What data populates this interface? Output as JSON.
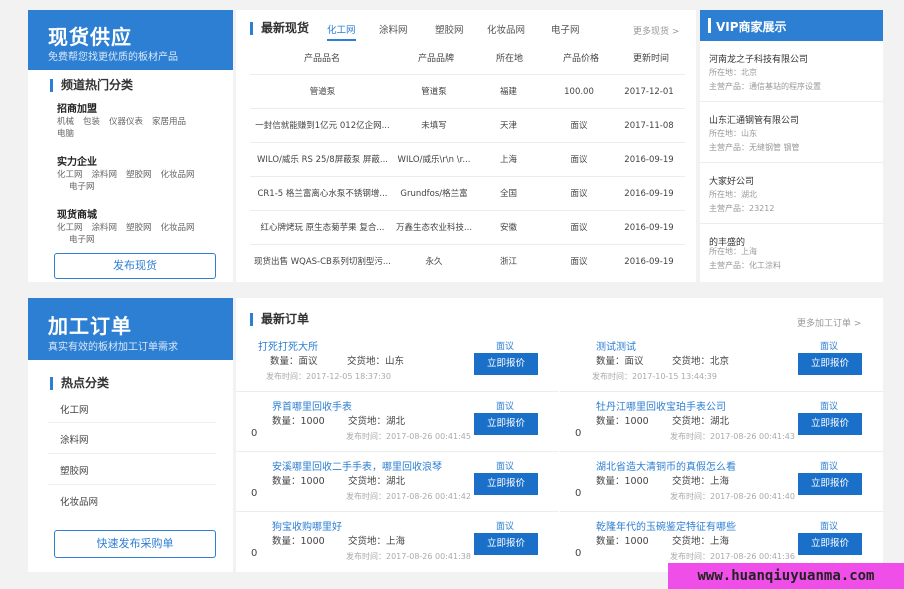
{
  "spot": {
    "title": "现货供应",
    "subtitle": "免费帮您找更优质的板材产品",
    "hot_title": "频道热门分类",
    "categories": [
      {
        "name": "招商加盟",
        "items": [
          "机械",
          "包装",
          "仪器仪表",
          "家居用品",
          "电脑"
        ]
      },
      {
        "name": "实力企业",
        "items": [
          "化工网",
          "涂料网",
          "塑胶网",
          "化妆品网",
          "电子网"
        ]
      },
      {
        "name": "现货商城",
        "items": [
          "化工网",
          "涂料网",
          "塑胶网",
          "化妆品网",
          "电子网"
        ]
      }
    ],
    "publish_button": "发布现货"
  },
  "latest_spot": {
    "title": "最新现货",
    "tabs": [
      "化工网",
      "涂料网",
      "塑胶网",
      "化妆品网",
      "电子网"
    ],
    "active_tab": 0,
    "more": "更多现货 >",
    "columns": [
      "产品品名",
      "产品品牌",
      "所在地",
      "产品价格",
      "更新时间"
    ],
    "rows": [
      [
        "管道泵",
        "管道泵",
        "福建",
        "100.00",
        "2017-12-01"
      ],
      [
        "一封信就能赚到1亿元 012亿企网...",
        "未填写",
        "天津",
        "面议",
        "2017-11-08"
      ],
      [
        "WILO/威乐 RS 25/8屏蔽泵 屏蔽...",
        "WILO/威乐\\r\\n \\r...",
        "上海",
        "面议",
        "2016-09-19"
      ],
      [
        "CR1-5 格兰富离心水泵不锈钢增...",
        "Grundfos/格兰富",
        "全国",
        "面议",
        "2016-09-19"
      ],
      [
        "红心牌烤玩 原生态菊芋果 复合...",
        "万鑫生态农业科技...",
        "安徽",
        "面议",
        "2016-09-19"
      ],
      [
        "现货出售 WQAS-CB系列切割型污...",
        "永久",
        "浙江",
        "面议",
        "2016-09-19"
      ]
    ]
  },
  "vip": {
    "title": "VIP商家展示",
    "items": [
      {
        "name": "河南龙之子科技有限公司",
        "location": "所在地：北京",
        "product": "主营产品：通信基站的程序设置"
      },
      {
        "name": "山东汇通钢管有限公司",
        "location": "所在地：山东",
        "product": "主营产品：无缝钢管 钢管"
      },
      {
        "name": "大家好公司",
        "location": "所在地：湖北",
        "product": "主营产品：23212"
      },
      {
        "name": "的丰盛的",
        "location": "所在地：上海",
        "product": "主营产品：化工涂料"
      }
    ]
  },
  "processing": {
    "title": "加工订单",
    "subtitle": "真实有效的板材加工订单需求",
    "hot_title": "热点分类",
    "categories": [
      "化工网",
      "涂料网",
      "塑胶网",
      "化妆品网"
    ],
    "publish_button": "快速发布采购单"
  },
  "latest_orders": {
    "title": "最新订单",
    "more": "更多加工订单 >",
    "orders": [
      {
        "title": "打死打死大所",
        "qty": "数量：面议",
        "place": "交货地：山东",
        "time": "发布时间：2017-12-05 18:37:30",
        "zero": "",
        "price": "面议",
        "button": "立即报价"
      },
      {
        "title": "测试测试",
        "qty": "数量：面议",
        "place": "交货地：北京",
        "time": "发布时间：2017-10-15 13:44:39",
        "zero": "",
        "price": "面议",
        "button": "立即报价"
      },
      {
        "title": "界首哪里回收手表",
        "qty": "数量：1000",
        "place": "交货地：湖北",
        "time": "发布时间：2017-08-26 00:41:45",
        "zero": "0",
        "price": "面议",
        "button": "立即报价"
      },
      {
        "title": "牡丹江哪里回收宝珀手表公司",
        "qty": "数量：1000",
        "place": "交货地：湖北",
        "time": "发布时间：2017-08-26 00:41:43",
        "zero": "0",
        "price": "面议",
        "button": "立即报价"
      },
      {
        "title": "安溪哪里回收二手手表，哪里回收浪琴",
        "qty": "数量：1000",
        "place": "交货地：湖北",
        "time": "发布时间：2017-08-26 00:41:42",
        "zero": "0",
        "price": "面议",
        "button": "立即报价"
      },
      {
        "title": "湖北省造大清铜币的真假怎么看",
        "qty": "数量：1000",
        "place": "交货地：上海",
        "time": "发布时间：2017-08-26 00:41:40",
        "zero": "0",
        "price": "面议",
        "button": "立即报价"
      },
      {
        "title": "狗宝收购哪里好",
        "qty": "数量：1000",
        "place": "交货地：上海",
        "time": "发布时间：2017-08-26 00:41:38",
        "zero": "0",
        "price": "面议",
        "button": "立即报价"
      },
      {
        "title": "乾隆年代的玉碗鉴定特征有哪些",
        "qty": "数量：1000",
        "place": "交货地：上海",
        "time": "发布时间：2017-08-26 00:41:36",
        "zero": "0",
        "price": "面议",
        "button": "立即报价"
      }
    ]
  },
  "watermark": "www.huanqiuyuanma.com",
  "colors": {
    "accent": "#2d7fd3",
    "button": "#1a6fc9",
    "watermark_bg": "#f04ee8"
  }
}
